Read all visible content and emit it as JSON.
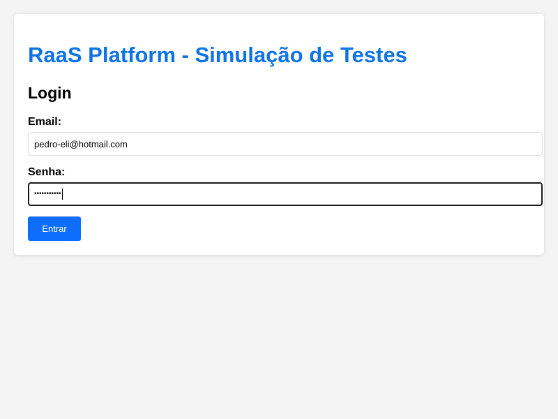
{
  "app": {
    "title": "RaaS Platform - Simulação de Testes"
  },
  "login": {
    "heading": "Login",
    "email_label": "Email:",
    "email_value": "pedro-eli@hotmail.com",
    "senha_label": "Senha:",
    "senha_masked": "•••••••••••",
    "submit_label": "Entrar"
  },
  "colors": {
    "title_accent": "#0f74e3",
    "button_bg": "#0d6efd",
    "page_bg": "#f4f4f4"
  }
}
